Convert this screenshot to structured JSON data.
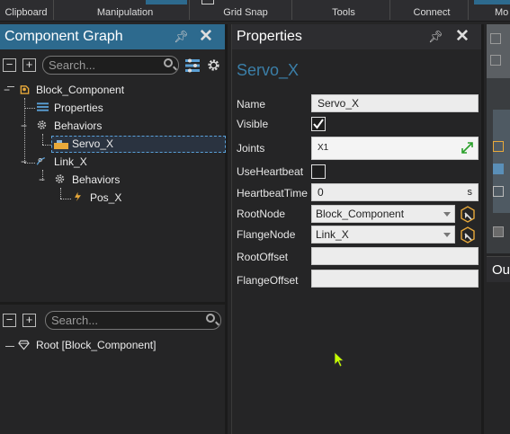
{
  "ribbon": {
    "groups": [
      "Clipboard",
      "Manipulation",
      "Grid Snap",
      "Tools",
      "Connect",
      "Mo"
    ]
  },
  "component_graph": {
    "title": "Component Graph",
    "search_placeholder": "Search...",
    "tree": {
      "root": "Block_Component",
      "properties": "Properties",
      "behaviors": "Behaviors",
      "servo": "Servo_X",
      "link": "Link_X",
      "link_behaviors": "Behaviors",
      "pos": "Pos_X"
    },
    "lower_search_placeholder": "Search...",
    "lower_tree_root": "Root [Block_Component]"
  },
  "properties": {
    "title": "Properties",
    "object_name": "Servo_X",
    "labels": {
      "name": "Name",
      "visible": "Visible",
      "joints": "Joints",
      "useheartbeat": "UseHeartbeat",
      "heartbeattime": "HeartbeatTime",
      "rootnode": "RootNode",
      "flangenode": "FlangeNode",
      "rootoffset": "RootOffset",
      "flangeoffset": "FlangeOffset"
    },
    "values": {
      "name": "Servo_X",
      "joints": "X1",
      "heartbeattime": "0",
      "heartbeat_unit": "s",
      "rootnode": "Block_Component",
      "flangenode": "Link_X",
      "rootoffset": "",
      "flangeoffset": ""
    },
    "visible_checked": true,
    "useheartbeat_checked": false
  },
  "right_panel": {
    "title_fragment": "Ou"
  },
  "colors": {
    "accent": "#2d6a8e",
    "object_name": "#3b7fa8",
    "selection_border": "#5aa0d8",
    "cursor": "#c6ff00"
  }
}
